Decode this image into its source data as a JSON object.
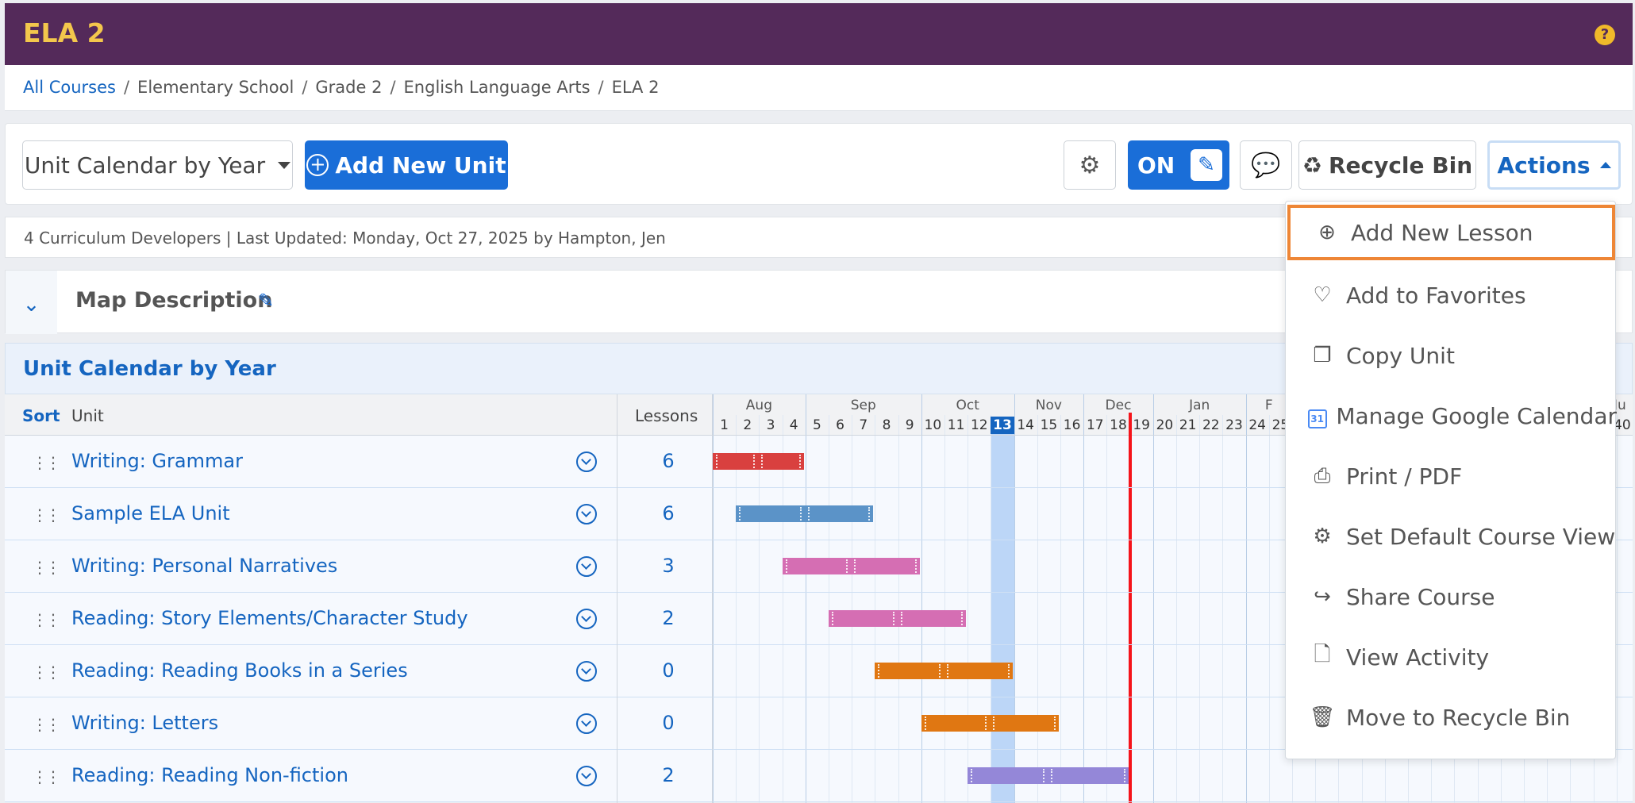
{
  "header": {
    "title": "ELA 2",
    "help": "?"
  },
  "breadcrumbs": [
    "All Courses",
    "Elementary School",
    "Grade 2",
    "English Language Arts",
    "ELA 2"
  ],
  "toolbar": {
    "view_select": "Unit Calendar by Year",
    "add_unit": "Add New Unit",
    "edit_toggle": "ON",
    "recycle_bin": "Recycle Bin",
    "actions": "Actions"
  },
  "meta": "4 Curriculum Developers | Last Updated: Monday, Oct 27, 2025 by Hampton, Jen",
  "map_description": "Map Description",
  "calendar_title": "Unit Calendar by Year",
  "table": {
    "sort": "Sort",
    "unit": "Unit",
    "lessons": "Lessons",
    "rows": [
      {
        "name": "Writing: Grammar",
        "lessons": "6",
        "color": "#d9403f",
        "start": 1,
        "end": 4
      },
      {
        "name": "Sample ELA Unit",
        "lessons": "6",
        "color": "#5b93c8",
        "start": 2,
        "end": 7
      },
      {
        "name": "Writing: Personal Narratives",
        "lessons": "3",
        "color": "#d56eb3",
        "start": 4,
        "end": 9
      },
      {
        "name": "Reading: Story Elements/Character Study",
        "lessons": "2",
        "color": "#d56eb3",
        "start": 6,
        "end": 11
      },
      {
        "name": "Reading: Reading Books in a Series",
        "lessons": "0",
        "color": "#e07712",
        "start": 8,
        "end": 13
      },
      {
        "name": "Writing: Letters",
        "lessons": "0",
        "color": "#e07712",
        "start": 10,
        "end": 15
      },
      {
        "name": "Reading: Reading Non-fiction",
        "lessons": "2",
        "color": "#9487d8",
        "start": 12,
        "end": 18
      }
    ]
  },
  "gantt": {
    "months": [
      {
        "label": "Aug",
        "from": 1,
        "to": 4
      },
      {
        "label": "Sep",
        "from": 5,
        "to": 9
      },
      {
        "label": "Oct",
        "from": 10,
        "to": 13
      },
      {
        "label": "Nov",
        "from": 14,
        "to": 16
      },
      {
        "label": "Dec",
        "from": 17,
        "to": 19
      },
      {
        "label": "Jan",
        "from": 20,
        "to": 23
      },
      {
        "label": "F",
        "from": 24,
        "to": 25
      }
    ],
    "weeks": [
      "1",
      "2",
      "3",
      "4",
      "5",
      "6",
      "7",
      "8",
      "9",
      "10",
      "11",
      "12",
      "13",
      "14",
      "15",
      "16",
      "17",
      "18",
      "19",
      "20",
      "21",
      "22",
      "23",
      "24",
      "25"
    ],
    "current_week": "13",
    "edge_month": "Ju",
    "edge_week": "40"
  },
  "menu": [
    {
      "label": "Add New Lesson",
      "icon": "plus-circle-icon"
    },
    {
      "label": "Add to Favorites",
      "icon": "heart-icon"
    },
    {
      "label": "Copy Unit",
      "icon": "copy-icon"
    },
    {
      "label": "Manage Google Calendar",
      "icon": "google-calendar-icon"
    },
    {
      "label": "Print / PDF",
      "icon": "printer-icon"
    },
    {
      "label": "Set Default Course View",
      "icon": "gear-icon"
    },
    {
      "label": "Share Course",
      "icon": "share-icon"
    },
    {
      "label": "View Activity",
      "icon": "activity-icon"
    },
    {
      "label": "Move to Recycle Bin",
      "icon": "recycle-bin-icon"
    }
  ]
}
